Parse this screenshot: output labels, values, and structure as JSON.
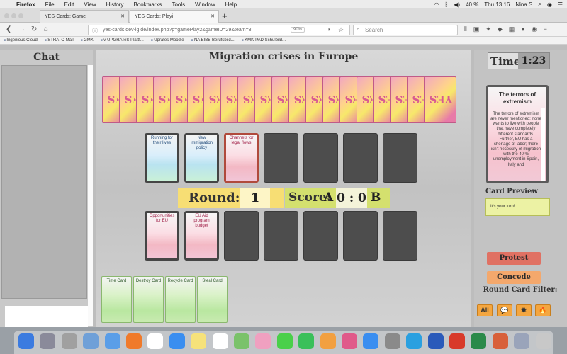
{
  "menubar": {
    "app_name": "Firefox",
    "items": [
      "File",
      "Edit",
      "View",
      "History",
      "Bookmarks",
      "Tools",
      "Window",
      "Help"
    ],
    "battery": "40 %",
    "clock": "Thu 13:16",
    "user": "Nina S"
  },
  "tabs": [
    {
      "title": "YES-Cards: Game"
    },
    {
      "title": "YES-Cards: Playi"
    }
  ],
  "navbar": {
    "url": "yes-cards.dev-lg.de/index.php?p=gamePlay2&gameID=29&team=3",
    "zoom": "90%",
    "search_placeholder": "Search"
  },
  "bookmarks": [
    "Ingenious Cloud",
    "STRATO Mail",
    "GMX",
    "v-UPGRATeS Plattf...",
    "Uprates Moodle",
    "NA BIBB Berufsbild...",
    "KMK-PAD Schulbild..."
  ],
  "chat": {
    "title": "Chat"
  },
  "game": {
    "title": "Migration crises in Europe",
    "deck_label": "YES",
    "deck_count": 20,
    "top_row": [
      {
        "text": "Running for their lives",
        "style": "blue"
      },
      {
        "text": "New immigration policy",
        "style": "blue"
      },
      {
        "text": "Channels for legal flows",
        "style": "red-selected"
      },
      {
        "text": "",
        "style": "empty"
      },
      {
        "text": "",
        "style": "empty"
      },
      {
        "text": "",
        "style": "empty"
      },
      {
        "text": "",
        "style": "empty"
      }
    ],
    "bottom_row": [
      {
        "text": "Opportunities for EU",
        "style": "red"
      },
      {
        "text": "EU Aid program budget",
        "style": "red"
      },
      {
        "text": "",
        "style": "empty"
      },
      {
        "text": "",
        "style": "empty"
      },
      {
        "text": "",
        "style": "empty"
      },
      {
        "text": "",
        "style": "empty"
      },
      {
        "text": "",
        "style": "empty"
      }
    ],
    "round_label": "Round:",
    "round_value": "1",
    "score_label": "Score:",
    "team_a": "A",
    "score_value": "0 : 0",
    "team_b": "B",
    "action_cards": [
      "Time Card",
      "Destroy Card",
      "Recycle Card",
      "Steal Card"
    ]
  },
  "side": {
    "time_label": "Time:",
    "time_value": "1:23",
    "preview_title": "The terrors of extremism",
    "preview_text": "The terrors of extremism are never mentioned; none wants to live with people that have completely different standards. Further, EU has a shortage of labor; there isn't necessity of migration with the 40 % unemployment in Spain, Italy and",
    "preview_label": "Card Preview",
    "message": "It's your turn!",
    "protest_label": "Protest",
    "concede_label": "Concede",
    "filter_label": "Round Card Filter:",
    "filters": [
      {
        "name": "all",
        "label": "All"
      },
      {
        "name": "speech",
        "label": "💬"
      },
      {
        "name": "burst",
        "label": "✹"
      },
      {
        "name": "flame",
        "label": "🔥"
      }
    ]
  },
  "colors": {
    "round_bg": "#f7de74",
    "score_bg": "#d4e06e",
    "protest": "#e07163",
    "concede": "#f4a86c",
    "filter": "#f4a640"
  },
  "dock_apps": [
    "finder",
    "launchpad",
    "system-preferences",
    "preview",
    "finder-folder",
    "firefox",
    "calendar",
    "safari",
    "notes",
    "reminders",
    "maps",
    "photos",
    "messages",
    "facetime",
    "books",
    "itunes",
    "app-store",
    "preferences",
    "skype",
    "word",
    "acrobat",
    "excel",
    "powerpoint",
    "documents",
    "trash"
  ]
}
